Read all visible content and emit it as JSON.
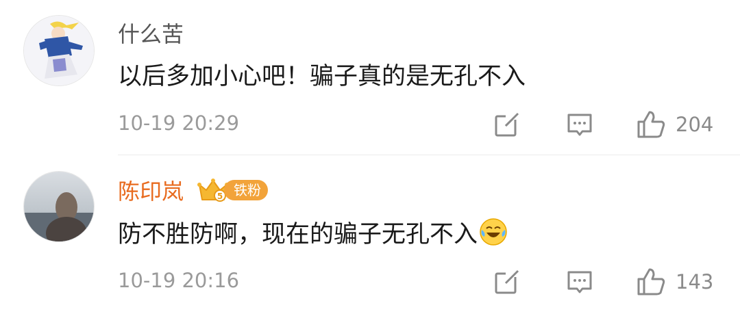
{
  "comments": [
    {
      "username": "什么苦",
      "text": "以后多加小心吧！骗子真的是无孔不入",
      "time": "10-19 20:29",
      "likes": "204"
    },
    {
      "username": "陈印岚",
      "badge": "铁粉",
      "text": "防不胜防啊，现在的骗子无孔不入",
      "time": "10-19 20:16",
      "likes": "143"
    }
  ],
  "colors": {
    "username_default": "#555555",
    "username_fan": "#e86b1f",
    "badge": "#f2a33a",
    "meta": "#9a9a9a"
  },
  "icons": [
    "share-icon",
    "comment-icon",
    "like-icon",
    "laugh-cry-emoji"
  ]
}
